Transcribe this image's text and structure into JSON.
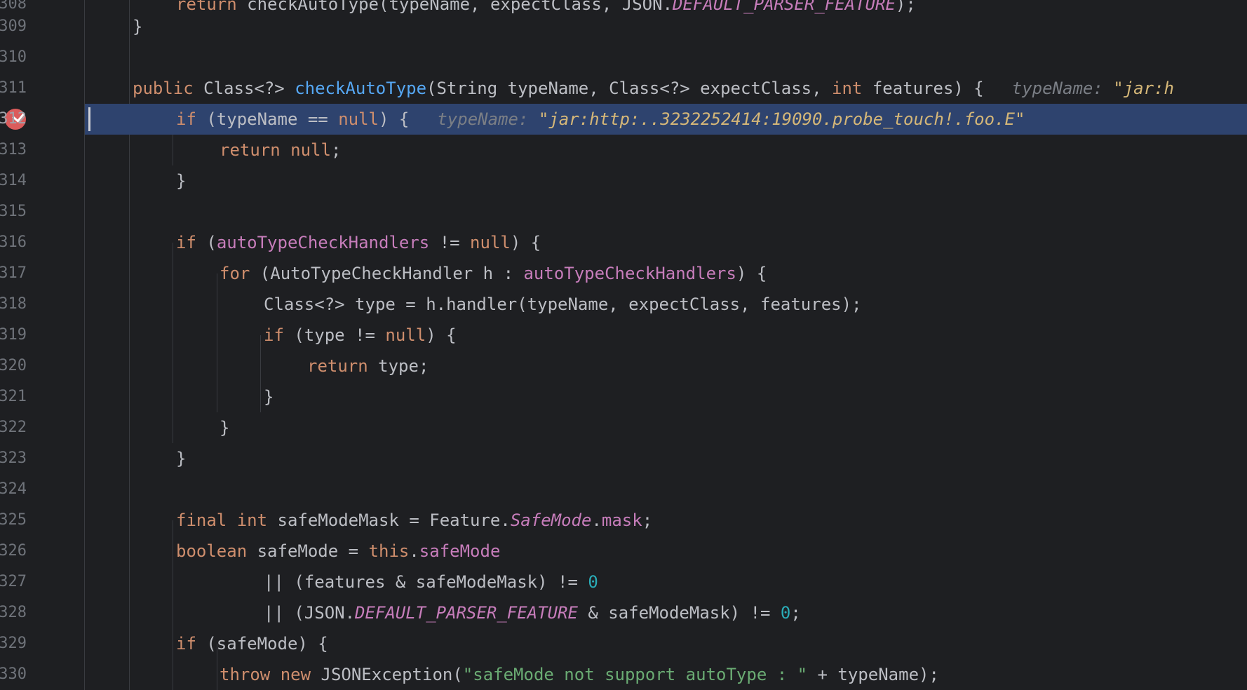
{
  "editor": {
    "colors": {
      "background": "#1e1f22",
      "execution_line": "#2e436e",
      "keyword": "#cf8e6d",
      "method": "#56a8f5",
      "field": "#c77dbb",
      "string": "#6aab73",
      "number": "#2aacb8",
      "inlay_hint": "#7a7e85",
      "inlay_value": "#d5b778",
      "breakpoint": "#db5c5c"
    },
    "line_numbers": [
      "308",
      "309",
      "310",
      "311",
      "312",
      "313",
      "314",
      "315",
      "316",
      "317",
      "318",
      "319",
      "320",
      "321",
      "322",
      "323",
      "324",
      "325",
      "326",
      "327",
      "328",
      "329",
      "330"
    ],
    "breakpoint_icon": "breakpoint-verified-icon",
    "lines": [
      {
        "tokens": [
          "return ",
          "checkAutoType",
          "(typeName, expectClass, JSON.",
          "DEFAULT_PARSER_FEATURE",
          ");"
        ]
      },
      {
        "tokens": [
          "}"
        ]
      },
      {
        "tokens": []
      },
      {
        "tokens": [
          "public ",
          "Class<?> ",
          "checkAutoType",
          "(String typeName, Class<?> expectClass, ",
          "int ",
          "features) {",
          "typeName: ",
          "\"jar:h"
        ]
      },
      {
        "tokens": [
          "if ",
          "(typeName == ",
          "null",
          ") {",
          "typeName: ",
          "\"jar:http:..3232252414:19090.probe_touch!.foo.E\""
        ]
      },
      {
        "tokens": [
          "return ",
          "null",
          ";"
        ]
      },
      {
        "tokens": [
          "}"
        ]
      },
      {
        "tokens": []
      },
      {
        "tokens": [
          "if ",
          "(",
          "autoTypeCheckHandlers",
          " != ",
          "null",
          ") {"
        ]
      },
      {
        "tokens": [
          "for ",
          "(AutoTypeCheckHandler h : ",
          "autoTypeCheckHandlers",
          ") {"
        ]
      },
      {
        "tokens": [
          "Class<?> type = h.handler(typeName, expectClass, features);"
        ]
      },
      {
        "tokens": [
          "if ",
          "(type != ",
          "null",
          ") {"
        ]
      },
      {
        "tokens": [
          "return ",
          "type;"
        ]
      },
      {
        "tokens": [
          "}"
        ]
      },
      {
        "tokens": [
          "}"
        ]
      },
      {
        "tokens": [
          "}"
        ]
      },
      {
        "tokens": []
      },
      {
        "tokens": [
          "final ",
          "int ",
          "safeModeMask = Feature.",
          "SafeMode",
          ".",
          "mask",
          ";"
        ]
      },
      {
        "tokens": [
          "boolean ",
          "safeMode = ",
          "this",
          ".",
          "safeMode"
        ]
      },
      {
        "tokens": [
          "|| (features & safeModeMask) != ",
          "0"
        ]
      },
      {
        "tokens": [
          "|| (JSON.",
          "DEFAULT_PARSER_FEATURE",
          " & safeModeMask) != ",
          "0",
          ";"
        ]
      },
      {
        "tokens": [
          "if ",
          "(safeMode) {"
        ]
      },
      {
        "tokens": [
          "throw ",
          "new ",
          "JSONException(",
          "\"safeMode not support autoType : \"",
          " + typeName);"
        ]
      }
    ]
  }
}
